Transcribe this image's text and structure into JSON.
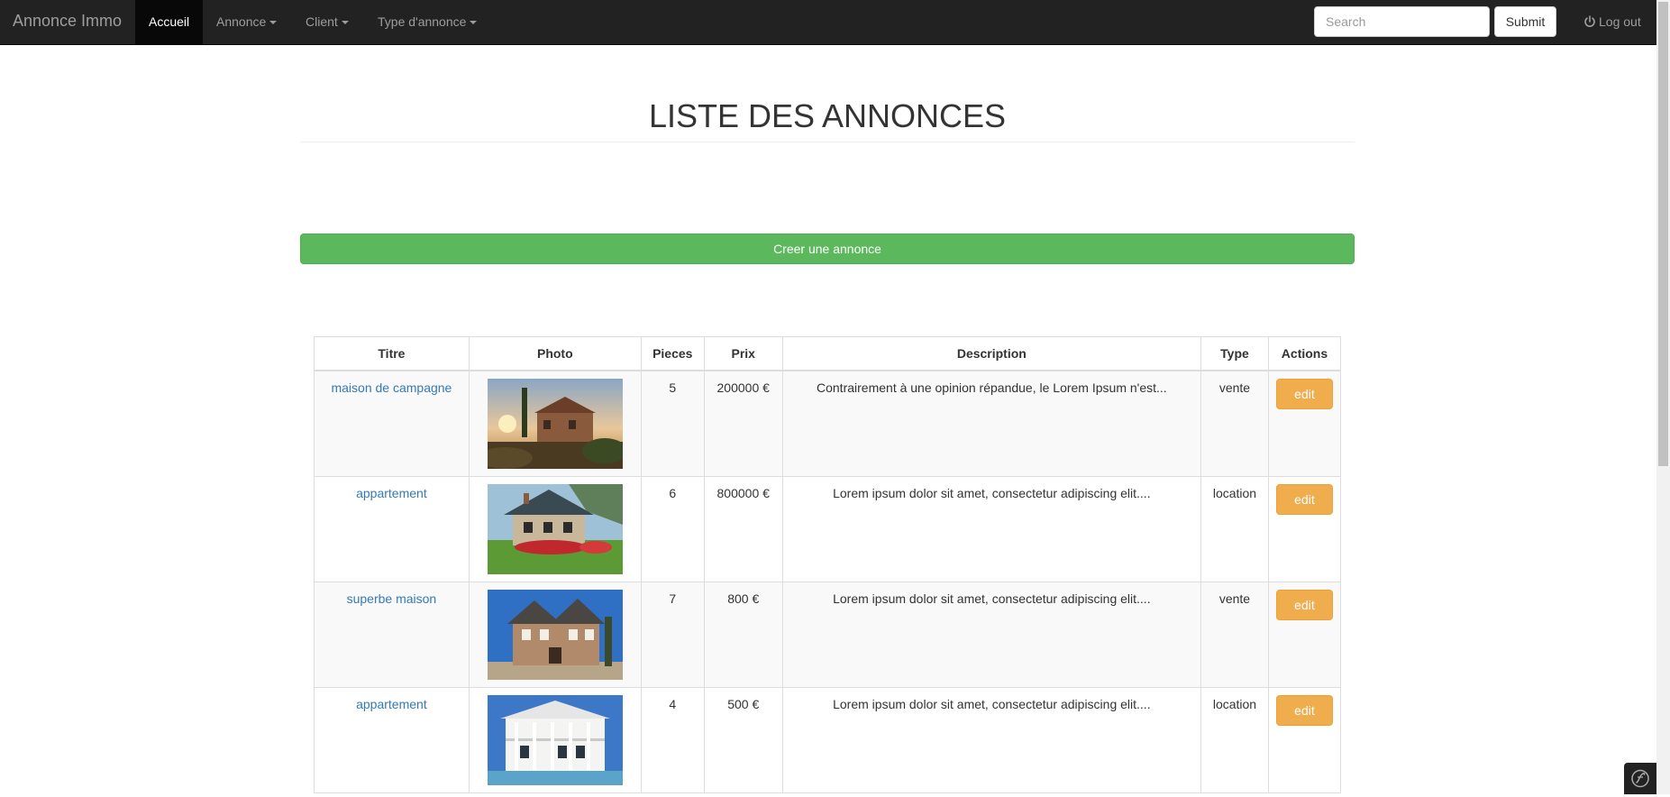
{
  "navbar": {
    "brand": "Annonce Immo",
    "items": [
      {
        "label": "Accueil",
        "active": true,
        "dropdown": false
      },
      {
        "label": "Annonce",
        "active": false,
        "dropdown": true
      },
      {
        "label": "Client",
        "active": false,
        "dropdown": true
      },
      {
        "label": "Type d'annonce",
        "active": false,
        "dropdown": true
      }
    ],
    "search_placeholder": "Search",
    "submit_label": "Submit",
    "logout_label": "Log out"
  },
  "page": {
    "title": "LISTE DES ANNONCES",
    "create_button": "Creer une annonce"
  },
  "table": {
    "headers": [
      "Titre",
      "Photo",
      "Pieces",
      "Prix",
      "Description",
      "Type",
      "Actions"
    ],
    "rows": [
      {
        "titre": "maison de campagne",
        "photo": "house-countryside-photo",
        "pieces": "5",
        "prix": "200000 €",
        "description": "Contrairement à une opinion répandue, le Lorem Ipsum n'est...",
        "type": "vente",
        "action": "edit"
      },
      {
        "titre": "appartement",
        "photo": "chalet-flowers-photo",
        "pieces": "6",
        "prix": "800000 €",
        "description": "Lorem ipsum dolor sit amet, consectetur adipiscing elit....",
        "type": "location",
        "action": "edit"
      },
      {
        "titre": "superbe maison",
        "photo": "brick-house-photo",
        "pieces": "7",
        "prix": "800 €",
        "description": "Lorem ipsum dolor sit amet, consectetur adipiscing elit....",
        "type": "vente",
        "action": "edit"
      },
      {
        "titre": "appartement",
        "photo": "white-villa-photo",
        "pieces": "4",
        "prix": "500 €",
        "description": "Lorem ipsum dolor sit amet, consectetur adipiscing elit....",
        "type": "location",
        "action": "edit"
      }
    ]
  },
  "colors": {
    "navbar_bg": "#222222",
    "success": "#5cb85c",
    "warning": "#f0ad4e",
    "link": "#337ab7"
  }
}
